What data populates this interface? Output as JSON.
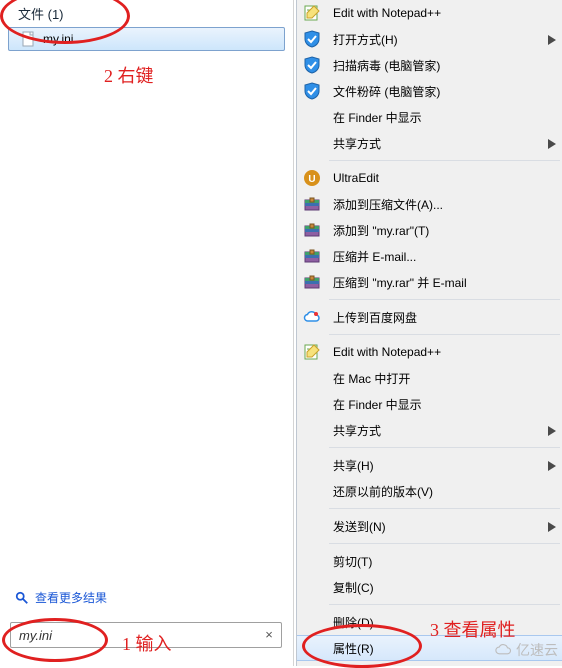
{
  "left": {
    "group_header": "文件 (1)",
    "file_name": "my.ini",
    "see_more": "查看更多结果",
    "search_value": "my.ini"
  },
  "menu": {
    "items": [
      {
        "label": "Edit with Notepad++",
        "icon": "notepad-icon",
        "submenu": false
      },
      {
        "label": "打开方式(H)",
        "icon": "shield-blue-icon",
        "submenu": true
      },
      {
        "label": "扫描病毒 (电脑管家)",
        "icon": "shield-blue-icon",
        "submenu": false
      },
      {
        "label": "文件粉碎 (电脑管家)",
        "icon": "shield-blue-icon",
        "submenu": false
      },
      {
        "label": "在 Finder 中显示",
        "icon": "",
        "submenu": false
      },
      {
        "label": "共享方式",
        "icon": "",
        "submenu": true
      },
      {
        "sep": true
      },
      {
        "label": "UltraEdit",
        "icon": "ultraedit-icon",
        "submenu": false
      },
      {
        "label": "添加到压缩文件(A)...",
        "icon": "winrar-icon",
        "submenu": false
      },
      {
        "label": "添加到 \"my.rar\"(T)",
        "icon": "winrar-icon",
        "submenu": false
      },
      {
        "label": "压缩并 E-mail...",
        "icon": "winrar-icon",
        "submenu": false
      },
      {
        "label": "压缩到 \"my.rar\" 并 E-mail",
        "icon": "winrar-icon",
        "submenu": false
      },
      {
        "sep": true
      },
      {
        "label": "上传到百度网盘",
        "icon": "baidu-cloud-icon",
        "submenu": false
      },
      {
        "sep": true
      },
      {
        "label": "Edit with Notepad++",
        "icon": "notepad-icon",
        "submenu": false
      },
      {
        "label": "在 Mac 中打开",
        "icon": "",
        "submenu": false
      },
      {
        "label": "在 Finder 中显示",
        "icon": "",
        "submenu": false
      },
      {
        "label": "共享方式",
        "icon": "",
        "submenu": true
      },
      {
        "sep": true
      },
      {
        "label": "共享(H)",
        "icon": "",
        "submenu": true
      },
      {
        "label": "还原以前的版本(V)",
        "icon": "",
        "submenu": false
      },
      {
        "sep": true
      },
      {
        "label": "发送到(N)",
        "icon": "",
        "submenu": true
      },
      {
        "sep": true
      },
      {
        "label": "剪切(T)",
        "icon": "",
        "submenu": false
      },
      {
        "label": "复制(C)",
        "icon": "",
        "submenu": false
      },
      {
        "sep": true
      },
      {
        "label": "删除(D)",
        "icon": "",
        "submenu": false
      },
      {
        "label": "属性(R)",
        "icon": "",
        "submenu": false,
        "hover": true
      }
    ]
  },
  "annotations": {
    "a1": "1 输入",
    "a2": "2 右键",
    "a3": "3 查看属性"
  },
  "watermark": "亿速云"
}
